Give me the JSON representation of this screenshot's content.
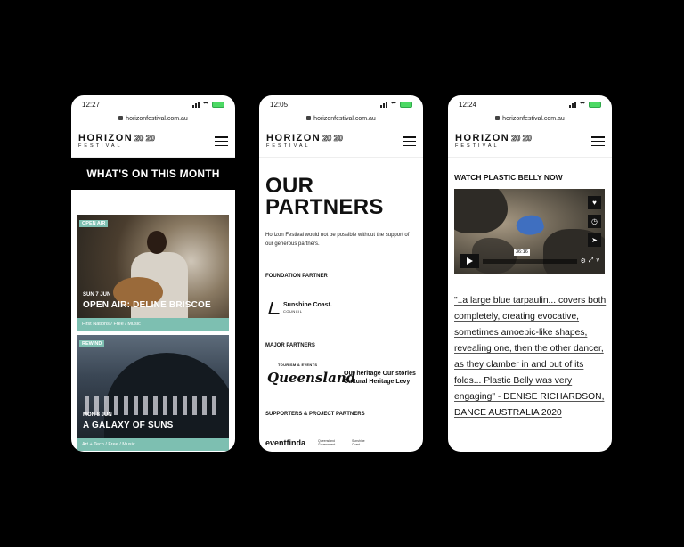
{
  "phones": [
    {
      "time": "12:27",
      "url": "horizonfestival.com.au",
      "logo": {
        "line1": "HORIZON",
        "year": "20 20",
        "line2": "FESTIVAL"
      },
      "heading": "WHAT'S ON THIS MONTH",
      "events": [
        {
          "tag": "OPEN AIR",
          "date": "SUN 7 JUN",
          "title": "OPEN AIR: DELINE BRISCOE",
          "categories": "First Nations / Free / Music"
        },
        {
          "tag": "REWIND",
          "date": "MON 8 JUN",
          "title": "A GALAXY OF SUNS",
          "categories": "Art + Tech / Free / Music"
        }
      ]
    },
    {
      "time": "12:05",
      "url": "horizonfestival.com.au",
      "logo": {
        "line1": "HORIZON",
        "year": "20 20",
        "line2": "FESTIVAL"
      },
      "heading_line1": "OUR",
      "heading_line2": "PARTNERS",
      "intro": "Horizon Festival would not be possible without the support of our generous partners.",
      "sections": {
        "foundation": "FOUNDATION PARTNER",
        "major": "MAJOR PARTNERS",
        "supporters": "SUPPORTERS & PROJECT PARTNERS"
      },
      "partner_logos": {
        "sunshine": "Sunshine Coast.",
        "sunshine_sub": "COUNCIL",
        "tourism_small": "TOURISM & EVENTS",
        "queensland": "Queensland",
        "heritage_line1": "Our heritage Our stories",
        "heritage_line2": "Cultural Heritage Levy",
        "eventfinda": "eventfinda",
        "qld_gov": "Queensland Government",
        "sunshine_small": "Sunshine Coast"
      }
    },
    {
      "time": "12:24",
      "url": "horizonfestival.com.au",
      "logo": {
        "line1": "HORIZON",
        "year": "20 20",
        "line2": "FESTIVAL"
      },
      "heading": "WATCH PLASTIC BELLY NOW",
      "video_time": "36:16",
      "quote": "\"..a large blue tarpaulin... covers both completely, creating evocative, sometimes amoebic-like shapes, revealing one, then the other dancer, as they clamber in and out of its folds... Plastic Belly was very engaging\" - DENISE RICHARDSON, DANCE AUSTRALIA 2020"
    }
  ],
  "colors": {
    "accent": "#7dbfb1",
    "background": "#000000"
  }
}
